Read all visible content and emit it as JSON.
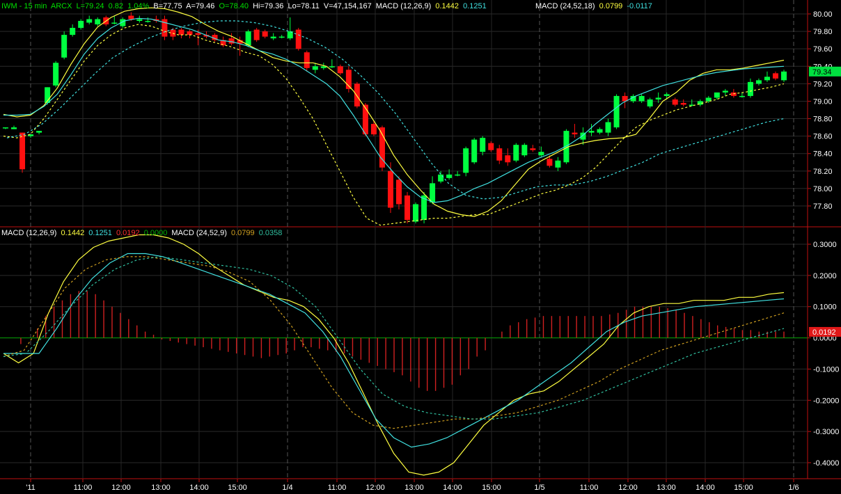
{
  "header": {
    "symbol": "IWM - 15 min",
    "exchange": "ARCX",
    "last": "L=79.24",
    "change": "0.82",
    "change_pct": "1.04%",
    "bid": "B=77.75",
    "ask": "A=79.46",
    "open": "O=78.40",
    "high": "Hi=79.36",
    "low": "Lo=78.11",
    "volume": "V=47,154,167",
    "macd1_label": "MACD (12,26,9)",
    "macd1_v1": "0.1442",
    "macd1_v2": "0.1251",
    "macd2_label": "MACD (24,52,18)",
    "macd2_v1": "0.0799",
    "macd2_v2": "-0.0117"
  },
  "lower_header": {
    "macd1_label": "MACD (12,26,9)",
    "macd1_v1": "0.1442",
    "macd1_v2": "0.1251",
    "macd1_v3": "0.0192",
    "macd1_v4": "0.0000",
    "macd2_label": "MACD (24,52,9)",
    "macd2_v1": "0.0799",
    "macd2_v2": "0.0358"
  },
  "chart_data": [
    {
      "type": "candlestick",
      "panel": "price",
      "y_ticks": [
        "80.00",
        "79.80",
        "79.60",
        "79.40",
        "79.20",
        "79.00",
        "78.80",
        "78.60",
        "78.40",
        "78.20",
        "78.00",
        "77.80"
      ],
      "ylim": [
        77.6,
        80.1
      ],
      "last_price_label": "79.34",
      "colors": {
        "up": "#00ff40",
        "down": "#ff1010",
        "bb_upper": "#ffff40",
        "bb_mid": "#40e0e0",
        "bb_lower": "#ffff40",
        "long_ma": "#40e0e0"
      },
      "candles": [
        [
          78.7,
          78.7,
          78.68,
          78.7
        ],
        [
          78.68,
          78.72,
          78.68,
          78.7
        ],
        [
          78.64,
          78.64,
          78.18,
          78.22
        ],
        [
          78.6,
          78.62,
          78.58,
          78.62
        ],
        [
          78.64,
          78.66,
          78.62,
          78.66
        ],
        [
          78.98,
          79.16,
          78.96,
          79.16
        ],
        [
          79.18,
          79.46,
          79.16,
          79.44
        ],
        [
          79.5,
          79.8,
          79.48,
          79.76
        ],
        [
          79.76,
          79.88,
          79.74,
          79.84
        ],
        [
          79.84,
          79.94,
          79.82,
          79.92
        ],
        [
          79.9,
          79.98,
          79.88,
          79.94
        ],
        [
          79.88,
          79.96,
          79.86,
          79.94
        ],
        [
          79.96,
          79.98,
          79.86,
          79.88
        ],
        [
          79.9,
          79.98,
          79.88,
          79.9
        ],
        [
          79.86,
          79.96,
          79.84,
          79.94
        ],
        [
          79.98,
          80.02,
          79.92,
          79.94
        ],
        [
          79.92,
          79.98,
          79.9,
          79.94
        ],
        [
          79.92,
          79.96,
          79.9,
          79.92
        ],
        [
          79.94,
          79.98,
          79.9,
          79.92
        ],
        [
          79.94,
          79.98,
          79.7,
          79.74
        ],
        [
          79.82,
          79.84,
          79.7,
          79.74
        ],
        [
          79.82,
          79.84,
          79.72,
          79.76
        ],
        [
          79.8,
          79.82,
          79.72,
          79.76
        ],
        [
          79.78,
          79.82,
          79.64,
          79.76
        ],
        [
          79.76,
          79.8,
          79.72,
          79.74
        ],
        [
          79.76,
          79.78,
          79.68,
          79.7
        ],
        [
          79.7,
          79.74,
          79.62,
          79.64
        ],
        [
          79.72,
          79.78,
          79.64,
          79.66
        ],
        [
          79.7,
          79.74,
          79.52,
          79.66
        ],
        [
          79.64,
          79.82,
          79.62,
          79.8
        ],
        [
          79.82,
          79.84,
          79.68,
          79.7
        ],
        [
          79.8,
          79.82,
          79.72,
          79.74
        ],
        [
          79.72,
          79.78,
          79.7,
          79.74
        ],
        [
          79.74,
          79.76,
          79.72,
          79.74
        ],
        [
          79.72,
          79.96,
          79.7,
          79.8
        ],
        [
          79.82,
          79.84,
          79.58,
          79.6
        ],
        [
          79.56,
          79.58,
          79.34,
          79.38
        ],
        [
          79.36,
          79.44,
          79.32,
          79.4
        ],
        [
          79.38,
          79.44,
          79.36,
          79.4
        ],
        [
          79.4,
          79.48,
          79.38,
          79.4
        ],
        [
          79.4,
          79.42,
          79.3,
          79.32
        ],
        [
          79.36,
          79.4,
          79.1,
          79.14
        ],
        [
          79.2,
          79.22,
          78.92,
          78.94
        ],
        [
          78.96,
          78.98,
          78.6,
          78.62
        ],
        [
          78.74,
          78.78,
          78.6,
          78.62
        ],
        [
          78.7,
          78.72,
          78.2,
          78.24
        ],
        [
          78.2,
          78.3,
          77.72,
          77.78
        ],
        [
          78.1,
          78.14,
          77.76,
          77.82
        ],
        [
          77.92,
          77.96,
          77.6,
          77.64
        ],
        [
          77.62,
          77.84,
          77.6,
          77.82
        ],
        [
          77.64,
          77.96,
          77.6,
          77.92
        ],
        [
          77.84,
          78.14,
          77.82,
          78.06
        ],
        [
          78.08,
          78.2,
          78.06,
          78.16
        ],
        [
          78.12,
          78.22,
          78.1,
          78.16
        ],
        [
          78.16,
          78.2,
          78.14,
          78.16
        ],
        [
          78.18,
          78.48,
          78.14,
          78.46
        ],
        [
          78.3,
          78.58,
          78.28,
          78.56
        ],
        [
          78.42,
          78.6,
          78.38,
          78.58
        ],
        [
          78.52,
          78.54,
          78.42,
          78.44
        ],
        [
          78.46,
          78.5,
          78.28,
          78.32
        ],
        [
          78.38,
          78.46,
          78.26,
          78.3
        ],
        [
          78.32,
          78.52,
          78.3,
          78.5
        ],
        [
          78.38,
          78.52,
          78.36,
          78.5
        ],
        [
          78.46,
          78.5,
          78.42,
          78.44
        ],
        [
          78.38,
          78.48,
          78.36,
          78.42
        ],
        [
          78.34,
          78.38,
          78.24,
          78.26
        ],
        [
          78.24,
          78.36,
          78.2,
          78.32
        ],
        [
          78.3,
          78.68,
          78.28,
          78.66
        ],
        [
          78.64,
          78.74,
          78.58,
          78.62
        ],
        [
          78.56,
          78.7,
          78.5,
          78.64
        ],
        [
          78.64,
          78.74,
          78.6,
          78.66
        ],
        [
          78.64,
          78.7,
          78.62,
          78.68
        ],
        [
          78.64,
          78.8,
          78.6,
          78.76
        ],
        [
          78.7,
          79.08,
          78.68,
          79.06
        ],
        [
          79.06,
          79.1,
          78.92,
          79.0
        ],
        [
          79.0,
          79.08,
          78.98,
          79.06
        ],
        [
          79.0,
          79.08,
          78.98,
          79.06
        ],
        [
          78.94,
          79.04,
          78.92,
          79.02
        ],
        [
          79.02,
          79.1,
          78.98,
          79.04
        ],
        [
          79.06,
          79.1,
          79.02,
          79.08
        ],
        [
          79.02,
          79.04,
          78.94,
          78.96
        ],
        [
          78.98,
          79.02,
          78.94,
          78.96
        ],
        [
          78.96,
          79.02,
          78.94,
          78.96
        ],
        [
          78.96,
          79.02,
          78.94,
          79.0
        ],
        [
          79.0,
          79.06,
          78.98,
          79.04
        ],
        [
          79.04,
          79.1,
          79.02,
          79.1
        ],
        [
          79.1,
          79.14,
          79.06,
          79.12
        ],
        [
          79.1,
          79.14,
          79.04,
          79.06
        ],
        [
          79.06,
          79.1,
          79.04,
          79.06
        ],
        [
          79.06,
          79.26,
          79.04,
          79.22
        ],
        [
          79.2,
          79.26,
          79.18,
          79.24
        ],
        [
          79.24,
          79.34,
          79.22,
          79.28
        ],
        [
          79.32,
          79.34,
          79.24,
          79.26
        ],
        [
          79.24,
          79.36,
          79.22,
          79.34
        ]
      ],
      "bb_upper": [
        78.85,
        78.82,
        78.84,
        78.95,
        79.15,
        79.42,
        79.66,
        79.85,
        79.96,
        80.03,
        80.06,
        80.07,
        80.06,
        80.02,
        79.97,
        79.88,
        79.8,
        79.74,
        79.66,
        79.58,
        79.5,
        79.46,
        79.44,
        79.44,
        79.4,
        79.28,
        79.12,
        78.9,
        78.66,
        78.38,
        78.16,
        77.98,
        77.82,
        77.74,
        77.7,
        77.68,
        77.74,
        77.86,
        78.04,
        78.22,
        78.32,
        78.4,
        78.48,
        78.52,
        78.55,
        78.57,
        78.58,
        78.62,
        78.8,
        79.0,
        79.1,
        79.24,
        79.32,
        79.36,
        79.36,
        79.38,
        79.41,
        79.44,
        79.47
      ],
      "bb_mid": [
        78.84,
        78.84,
        78.85,
        78.94,
        79.08,
        79.3,
        79.54,
        79.72,
        79.84,
        79.92,
        79.95,
        79.94,
        79.9,
        79.86,
        79.82,
        79.76,
        79.7,
        79.68,
        79.64,
        79.58,
        79.54,
        79.48,
        79.4,
        79.3,
        79.2,
        79.06,
        78.84,
        78.6,
        78.36,
        78.18,
        78.02,
        77.9,
        77.84,
        77.86,
        77.92,
        78.0,
        78.06,
        78.14,
        78.22,
        78.3,
        78.36,
        78.42,
        78.5,
        78.6,
        78.74,
        78.86,
        78.98,
        79.06,
        79.12,
        79.18,
        79.22,
        79.26,
        79.3,
        79.33,
        79.35,
        79.37,
        79.38,
        79.39,
        79.4
      ],
      "bb_lower": [
        78.6,
        78.58,
        78.62,
        78.8,
        79.02,
        79.24,
        79.46,
        79.64,
        79.76,
        79.84,
        79.88,
        79.86,
        79.8,
        79.76,
        79.76,
        79.7,
        79.66,
        79.62,
        79.56,
        79.52,
        79.42,
        79.26,
        79.04,
        78.8,
        78.5,
        78.2,
        77.9,
        77.66,
        77.58,
        77.6,
        77.62,
        77.64,
        77.66,
        77.66,
        77.68,
        77.7,
        77.7,
        77.76,
        77.82,
        77.88,
        77.94,
        77.98,
        78.04,
        78.12,
        78.24,
        78.4,
        78.56,
        78.7,
        78.78,
        78.84,
        78.9,
        78.94,
        78.98,
        79.02,
        79.08,
        79.1,
        79.13,
        79.16,
        79.2
      ],
      "long_ma": [
        78.58,
        78.62,
        78.74,
        78.92,
        79.12,
        79.32,
        79.5,
        79.62,
        79.72,
        79.8,
        79.86,
        79.9,
        79.92,
        79.92,
        79.9,
        79.86,
        79.8,
        79.72,
        79.62,
        79.48,
        79.3,
        79.1,
        78.86,
        78.58,
        78.3,
        78.06,
        77.92,
        77.88,
        77.9,
        77.96,
        78.02,
        78.04,
        78.04,
        78.08,
        78.14,
        78.22,
        78.3,
        78.4,
        78.46,
        78.52,
        78.58,
        78.64,
        78.7,
        78.76,
        78.8
      ]
    },
    {
      "type": "line+histogram",
      "panel": "macd",
      "y_ticks": [
        "0.3000",
        "0.2000",
        "0.1000",
        "0.0000",
        "-0.1000",
        "-0.2000",
        "-0.3000",
        "-0.4000"
      ],
      "ylim": [
        -0.44,
        0.34
      ],
      "last_value_label": "0.0192",
      "x_ticks": [
        "'11",
        "11:00",
        "12:00",
        "13:00",
        "14:00",
        "15:00",
        "1/4",
        "11:00",
        "12:00",
        "13:00",
        "14:00",
        "15:00",
        "1/5",
        "11:00",
        "12:00",
        "13:00",
        "14:00",
        "15:00",
        "1/6"
      ],
      "x_tick_positions": [
        44,
        119,
        174,
        231,
        286,
        341,
        413,
        484,
        539,
        595,
        650,
        706,
        775,
        846,
        902,
        957,
        1013,
        1068,
        1140
      ],
      "x_range": [
        0,
        1160
      ],
      "colors": {
        "macd": "#ffff40",
        "signal": "#40e0e0",
        "macd2": "#d0a020",
        "signal2": "#30c0a0",
        "hist": "#d02020"
      },
      "macd": [
        -0.05,
        -0.08,
        -0.05,
        0.08,
        0.18,
        0.25,
        0.29,
        0.31,
        0.32,
        0.33,
        0.33,
        0.32,
        0.3,
        0.27,
        0.23,
        0.2,
        0.17,
        0.15,
        0.13,
        0.12,
        0.1,
        0.06,
        0.0,
        -0.08,
        -0.18,
        -0.28,
        -0.37,
        -0.43,
        -0.44,
        -0.43,
        -0.4,
        -0.34,
        -0.28,
        -0.24,
        -0.2,
        -0.18,
        -0.17,
        -0.14,
        -0.1,
        -0.06,
        -0.02,
        0.04,
        0.08,
        0.1,
        0.11,
        0.11,
        0.12,
        0.12,
        0.12,
        0.13,
        0.13,
        0.14,
        0.145
      ],
      "signal": [
        -0.05,
        -0.05,
        -0.05,
        0.03,
        0.12,
        0.19,
        0.24,
        0.27,
        0.27,
        0.26,
        0.24,
        0.22,
        0.2,
        0.18,
        0.16,
        0.14,
        0.11,
        0.08,
        0.02,
        -0.06,
        -0.16,
        -0.26,
        -0.32,
        -0.35,
        -0.34,
        -0.32,
        -0.29,
        -0.26,
        -0.23,
        -0.2,
        -0.16,
        -0.12,
        -0.08,
        -0.03,
        0.02,
        0.05,
        0.07,
        0.08,
        0.09,
        0.1,
        0.105,
        0.11,
        0.115,
        0.12,
        0.125
      ],
      "macd2": [
        -0.06,
        -0.04,
        0.06,
        0.16,
        0.22,
        0.25,
        0.26,
        0.26,
        0.25,
        0.24,
        0.23,
        0.21,
        0.18,
        0.12,
        0.04,
        -0.06,
        -0.16,
        -0.24,
        -0.28,
        -0.29,
        -0.28,
        -0.27,
        -0.26,
        -0.26,
        -0.25,
        -0.24,
        -0.22,
        -0.2,
        -0.17,
        -0.14,
        -0.1,
        -0.07,
        -0.04,
        -0.02,
        0.0,
        0.02,
        0.04,
        0.06,
        0.08
      ],
      "signal2": [
        -0.06,
        -0.05,
        0.02,
        0.1,
        0.17,
        0.22,
        0.25,
        0.26,
        0.25,
        0.24,
        0.23,
        0.22,
        0.2,
        0.16,
        0.1,
        0.0,
        -0.1,
        -0.18,
        -0.22,
        -0.24,
        -0.25,
        -0.26,
        -0.26,
        -0.25,
        -0.24,
        -0.22,
        -0.2,
        -0.17,
        -0.14,
        -0.11,
        -0.08,
        -0.05,
        -0.03,
        -0.01,
        0.01,
        0.03
      ],
      "hist": [
        0.0,
        -0.02,
        0.0,
        0.03,
        0.07,
        0.1,
        0.12,
        0.14,
        0.15,
        0.15,
        0.14,
        0.12,
        0.1,
        0.08,
        0.06,
        0.04,
        0.02,
        0.01,
        -0.005,
        -0.01,
        -0.015,
        -0.02,
        -0.025,
        -0.03,
        -0.035,
        -0.04,
        -0.045,
        -0.05,
        -0.055,
        -0.06,
        -0.065,
        -0.06,
        -0.055,
        -0.05,
        -0.04,
        -0.03,
        -0.03,
        -0.035,
        -0.04,
        -0.045,
        -0.05,
        -0.06,
        -0.07,
        -0.08,
        -0.09,
        -0.1,
        -0.11,
        -0.12,
        -0.14,
        -0.16,
        -0.17,
        -0.17,
        -0.16,
        -0.15,
        -0.12,
        -0.1,
        -0.06,
        -0.04,
        0.0,
        0.02,
        0.04,
        0.05,
        0.06,
        0.065,
        0.07,
        0.07,
        0.07,
        0.07,
        0.07,
        0.07,
        0.07,
        0.07,
        0.075,
        0.08,
        0.09,
        0.1,
        0.1,
        0.1,
        0.1,
        0.095,
        0.09,
        0.08,
        0.07,
        0.06,
        0.05,
        0.04,
        0.035,
        0.03,
        0.025,
        0.025,
        0.02,
        0.02,
        0.02,
        0.02
      ]
    }
  ]
}
